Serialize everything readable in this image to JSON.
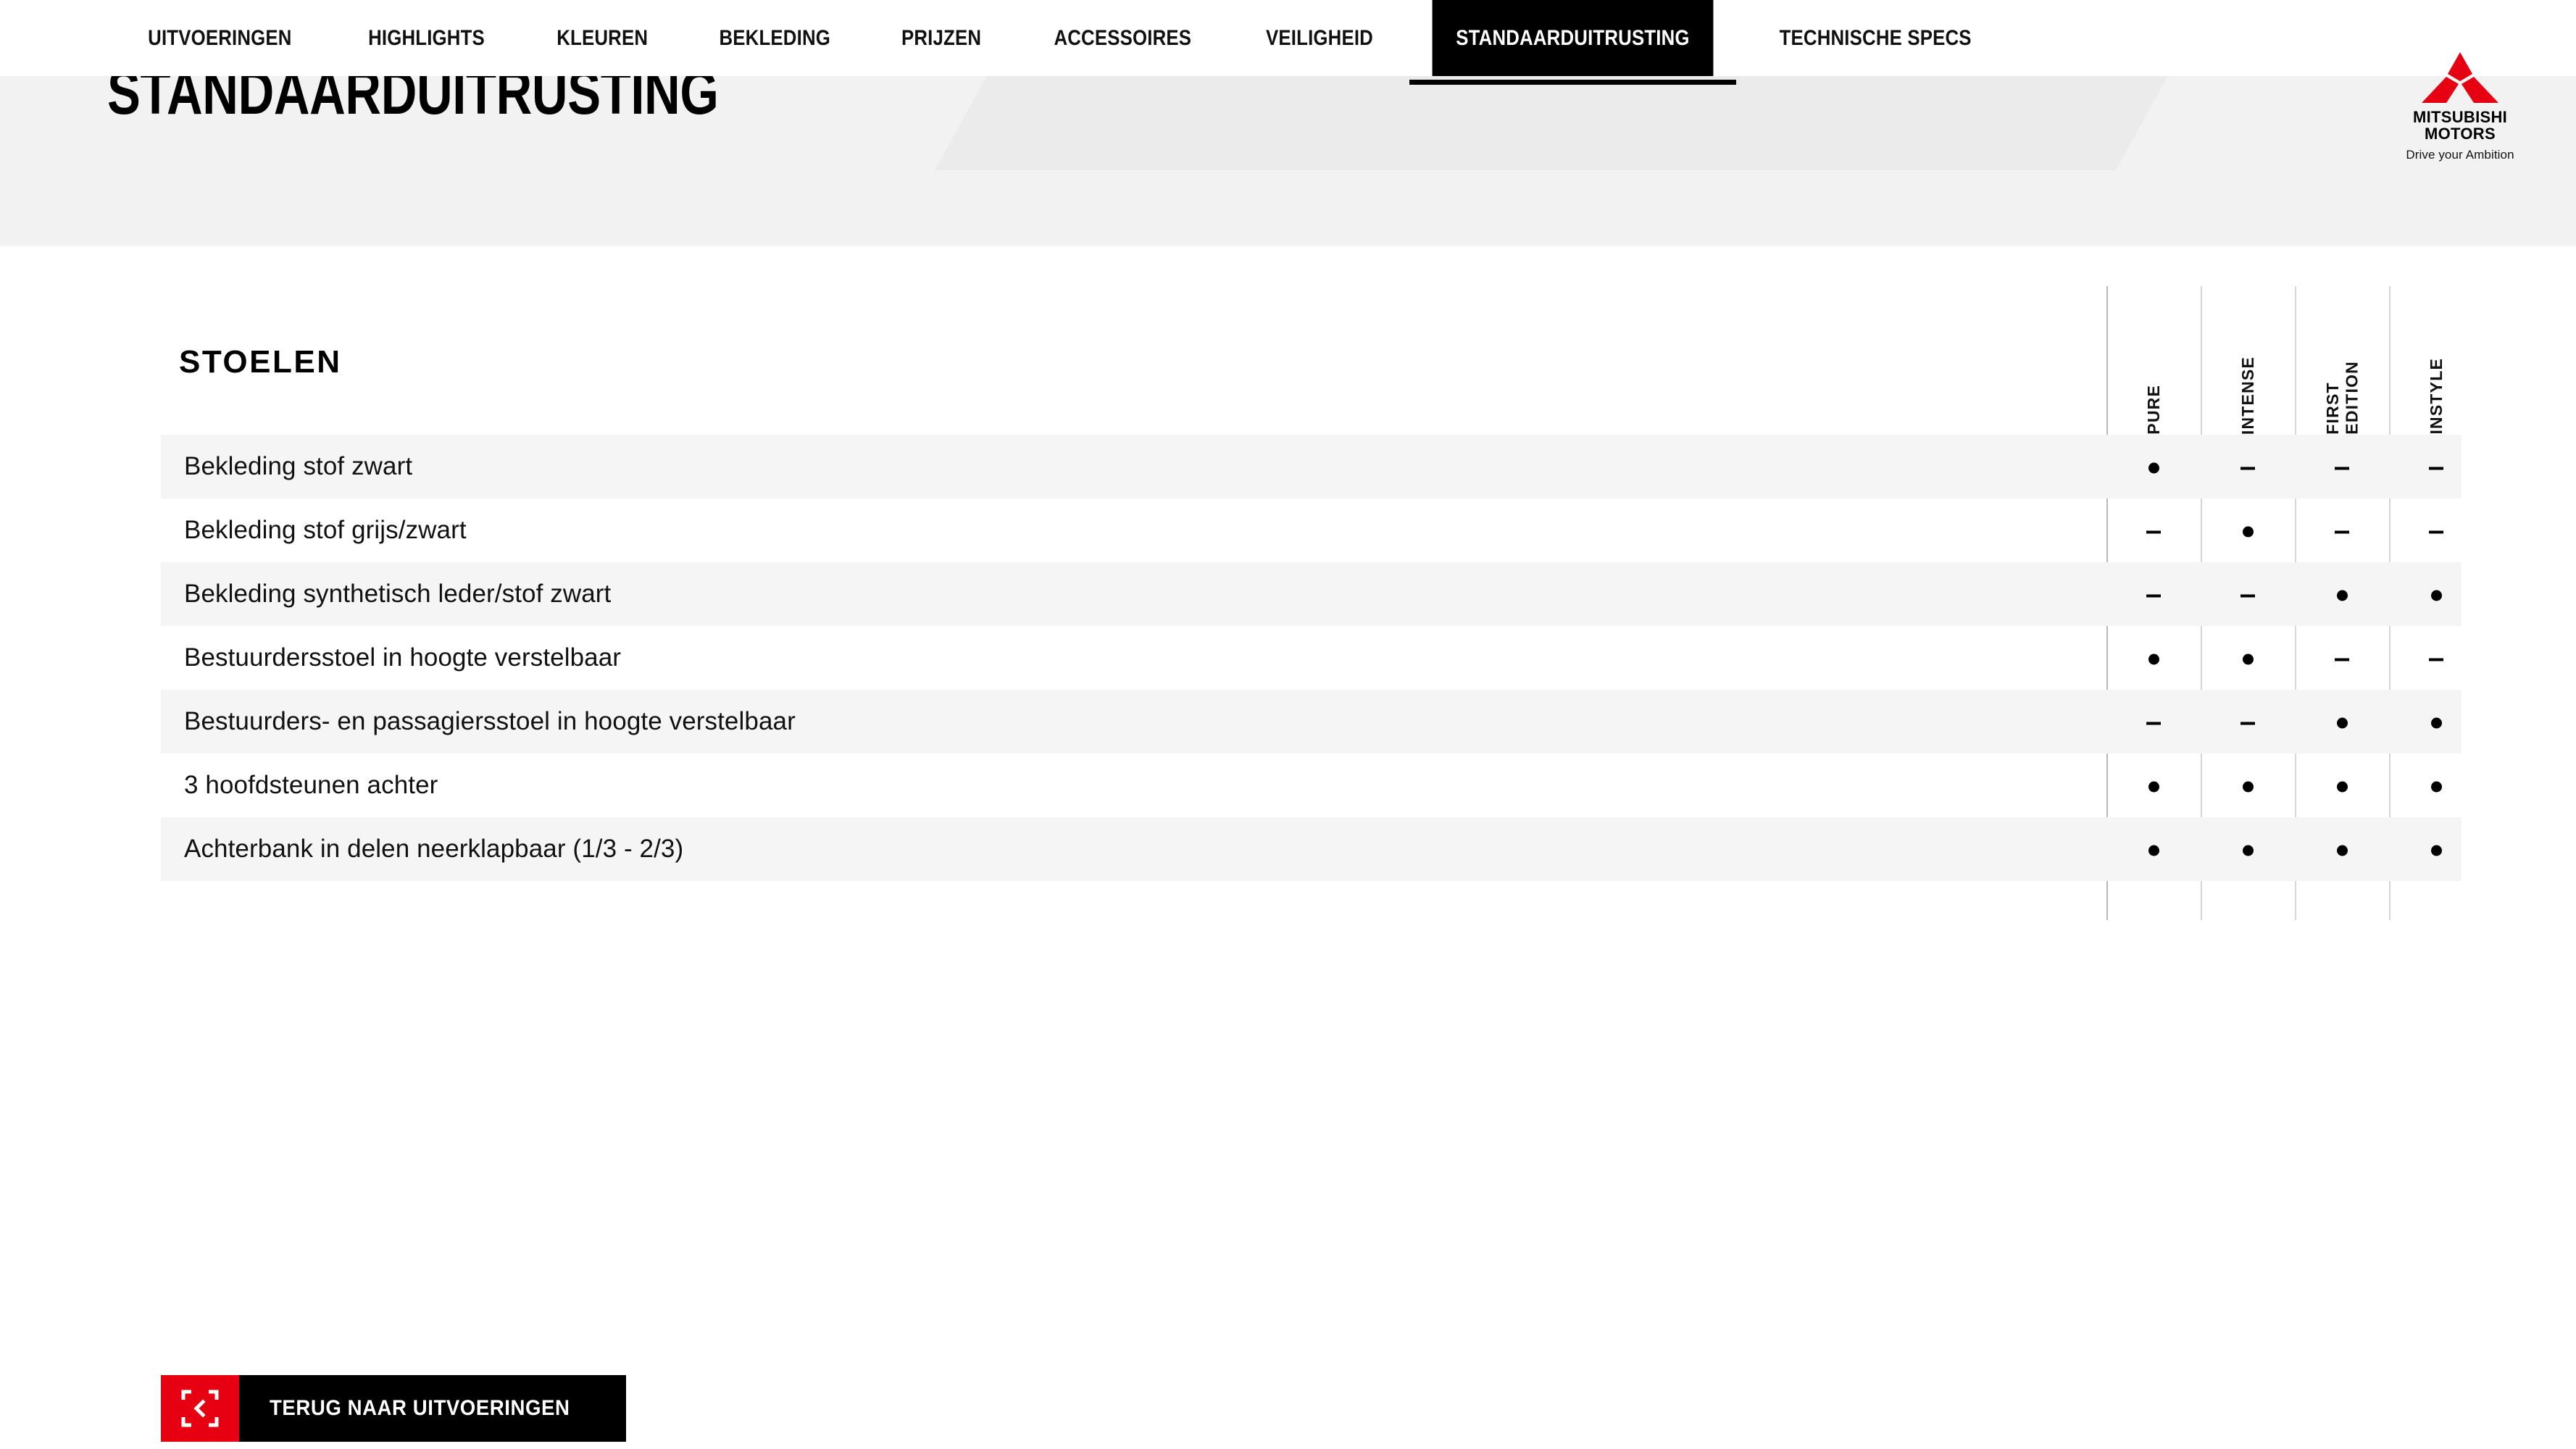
{
  "nav": {
    "items": [
      {
        "label": "UITVOERINGEN",
        "active": false
      },
      {
        "label": "HIGHLIGHTS",
        "active": false
      },
      {
        "label": "KLEUREN",
        "active": false
      },
      {
        "label": "BEKLEDING",
        "active": false
      },
      {
        "label": "PRIJZEN",
        "active": false
      },
      {
        "label": "ACCESSOIRES",
        "active": false
      },
      {
        "label": "VEILIGHEID",
        "active": false
      },
      {
        "label": "STANDAARDUITRUSTING",
        "active": true
      },
      {
        "label": "TECHNISCHE SPECS",
        "active": false
      }
    ]
  },
  "banner": {
    "title": "STANDAARDUITRUSTING"
  },
  "logo": {
    "name_line1": "MITSUBISHI",
    "name_line2": "MOTORS",
    "tagline": "Drive your Ambition",
    "mark_color": "#e60012",
    "icon": "mitsubishi-three-diamonds"
  },
  "section": {
    "title": "STOELEN"
  },
  "table": {
    "columns": [
      "PURE",
      "INTENSE",
      "FIRST\nEDITION",
      "INSTYLE"
    ],
    "rows": [
      {
        "label": "Bekleding stof zwart",
        "values": [
          "dot",
          "dash",
          "dash",
          "dash"
        ]
      },
      {
        "label": "Bekleding stof grijs/zwart",
        "values": [
          "dash",
          "dot",
          "dash",
          "dash"
        ]
      },
      {
        "label": "Bekleding synthetisch leder/stof zwart",
        "values": [
          "dash",
          "dash",
          "dot",
          "dot"
        ]
      },
      {
        "label": "Bestuurdersstoel in hoogte verstelbaar",
        "values": [
          "dot",
          "dot",
          "dash",
          "dash"
        ]
      },
      {
        "label": "Bestuurders- en passagiersstoel in hoogte verstelbaar",
        "values": [
          "dash",
          "dash",
          "dot",
          "dot"
        ]
      },
      {
        "label": "3 hoofdsteunen achter",
        "values": [
          "dot",
          "dot",
          "dot",
          "dot"
        ]
      },
      {
        "label": "Achterbank in delen neerklapbaar (1/3 - 2/3)",
        "values": [
          "dot",
          "dot",
          "dot",
          "dot"
        ]
      }
    ]
  },
  "back_button": {
    "label": "TERUG NAAR UITVOERINGEN",
    "icon": "frame-back-chevron-icon",
    "icon_bg": "#e60012",
    "label_bg": "#000000"
  }
}
